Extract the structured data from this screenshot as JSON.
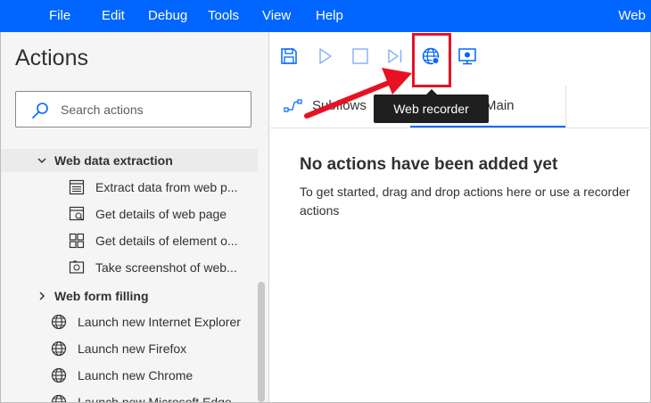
{
  "menubar": {
    "items": [
      "File",
      "Edit",
      "Debug",
      "Tools",
      "View",
      "Help"
    ],
    "window_title": "Web"
  },
  "actions_panel": {
    "title": "Actions",
    "search_placeholder": "Search actions",
    "groups": [
      {
        "label": "Web data extraction",
        "expanded": true,
        "items": [
          {
            "label": "Extract data from web p...",
            "icon": "extract-data-icon"
          },
          {
            "label": "Get details of web page",
            "icon": "web-page-details-icon"
          },
          {
            "label": "Get details of element o...",
            "icon": "element-details-icon"
          },
          {
            "label": "Take screenshot of web...",
            "icon": "screenshot-icon"
          }
        ]
      },
      {
        "label": "Web form filling",
        "expanded": false,
        "items": []
      }
    ],
    "browser_items": [
      {
        "label": "Launch new Internet Explorer",
        "icon": "globe-icon"
      },
      {
        "label": "Launch new Firefox",
        "icon": "globe-icon"
      },
      {
        "label": "Launch new Chrome",
        "icon": "globe-icon"
      },
      {
        "label": "Launch new Microsoft Edge",
        "icon": "globe-icon"
      }
    ]
  },
  "toolbar": {
    "buttons": [
      "save-icon",
      "run-icon",
      "stop-icon",
      "next-action-icon",
      "web-recorder-icon",
      "desktop-recorder-icon"
    ],
    "tooltip": "Web recorder"
  },
  "tabs": {
    "subflows_label": "Subflows",
    "main_label": "Main"
  },
  "empty_state": {
    "title": "No actions have been added yet",
    "line1": "To get started, drag and drop actions here or use a recorder",
    "line2": "actions"
  },
  "colors": {
    "menubar": "#0066ff",
    "accent": "#0066ff",
    "highlight": "#e81123",
    "tooltip_bg": "#1f1f1f"
  }
}
